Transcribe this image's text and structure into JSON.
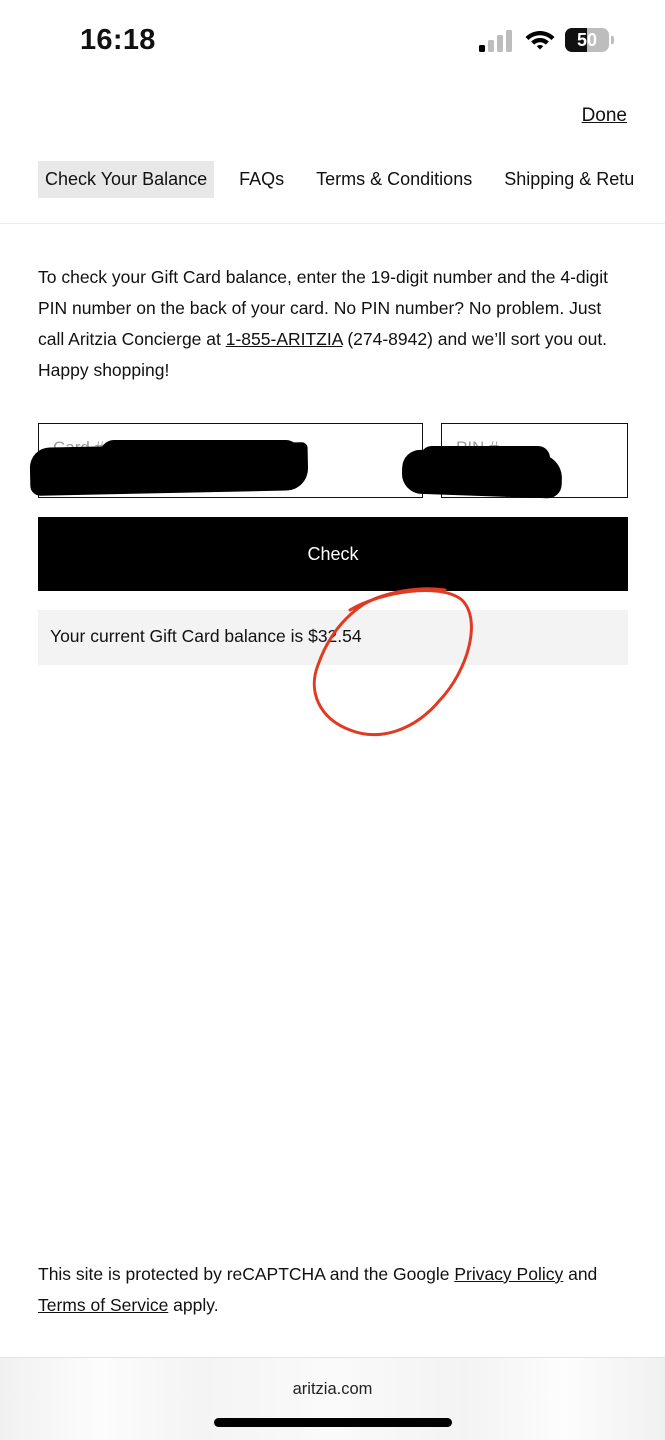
{
  "status_bar": {
    "time": "16:18",
    "battery_percent": 50,
    "battery_label": "50",
    "signal_bars_active": 1,
    "signal_bars_total": 4
  },
  "header": {
    "done_label": "Done"
  },
  "tabs": [
    {
      "label": "Check Your Balance",
      "active": true
    },
    {
      "label": "FAQs",
      "active": false
    },
    {
      "label": "Terms & Conditions",
      "active": false
    },
    {
      "label": "Shipping & Retu",
      "active": false
    }
  ],
  "intro": {
    "text_before_link": "To check your Gift Card balance, enter the 19-digit number and the 4-digit PIN number on the back of your card. No PIN number? No problem. Just call Aritzia Concierge at ",
    "phone_link": "1-855-ARITZIA",
    "text_after_link": " (274-8942) and we’ll sort you out. Happy shopping!"
  },
  "form": {
    "card_placeholder": "Card # (19 Digits)",
    "pin_placeholder": "PIN #",
    "check_label": "Check"
  },
  "balance": {
    "message": "Your current Gift Card balance is $32.54"
  },
  "footer": {
    "recaptcha_prefix": "This site is protected by reCAPTCHA and the Google ",
    "privacy_label": "Privacy Policy",
    "recaptcha_middle": " and ",
    "terms_label": "Terms of Service",
    "recaptcha_suffix": " apply."
  },
  "browser": {
    "url": "aritzia.com"
  },
  "colors": {
    "annotation": "#e03a22",
    "button_bg": "#000000",
    "balance_bg": "#f3f3f3"
  }
}
